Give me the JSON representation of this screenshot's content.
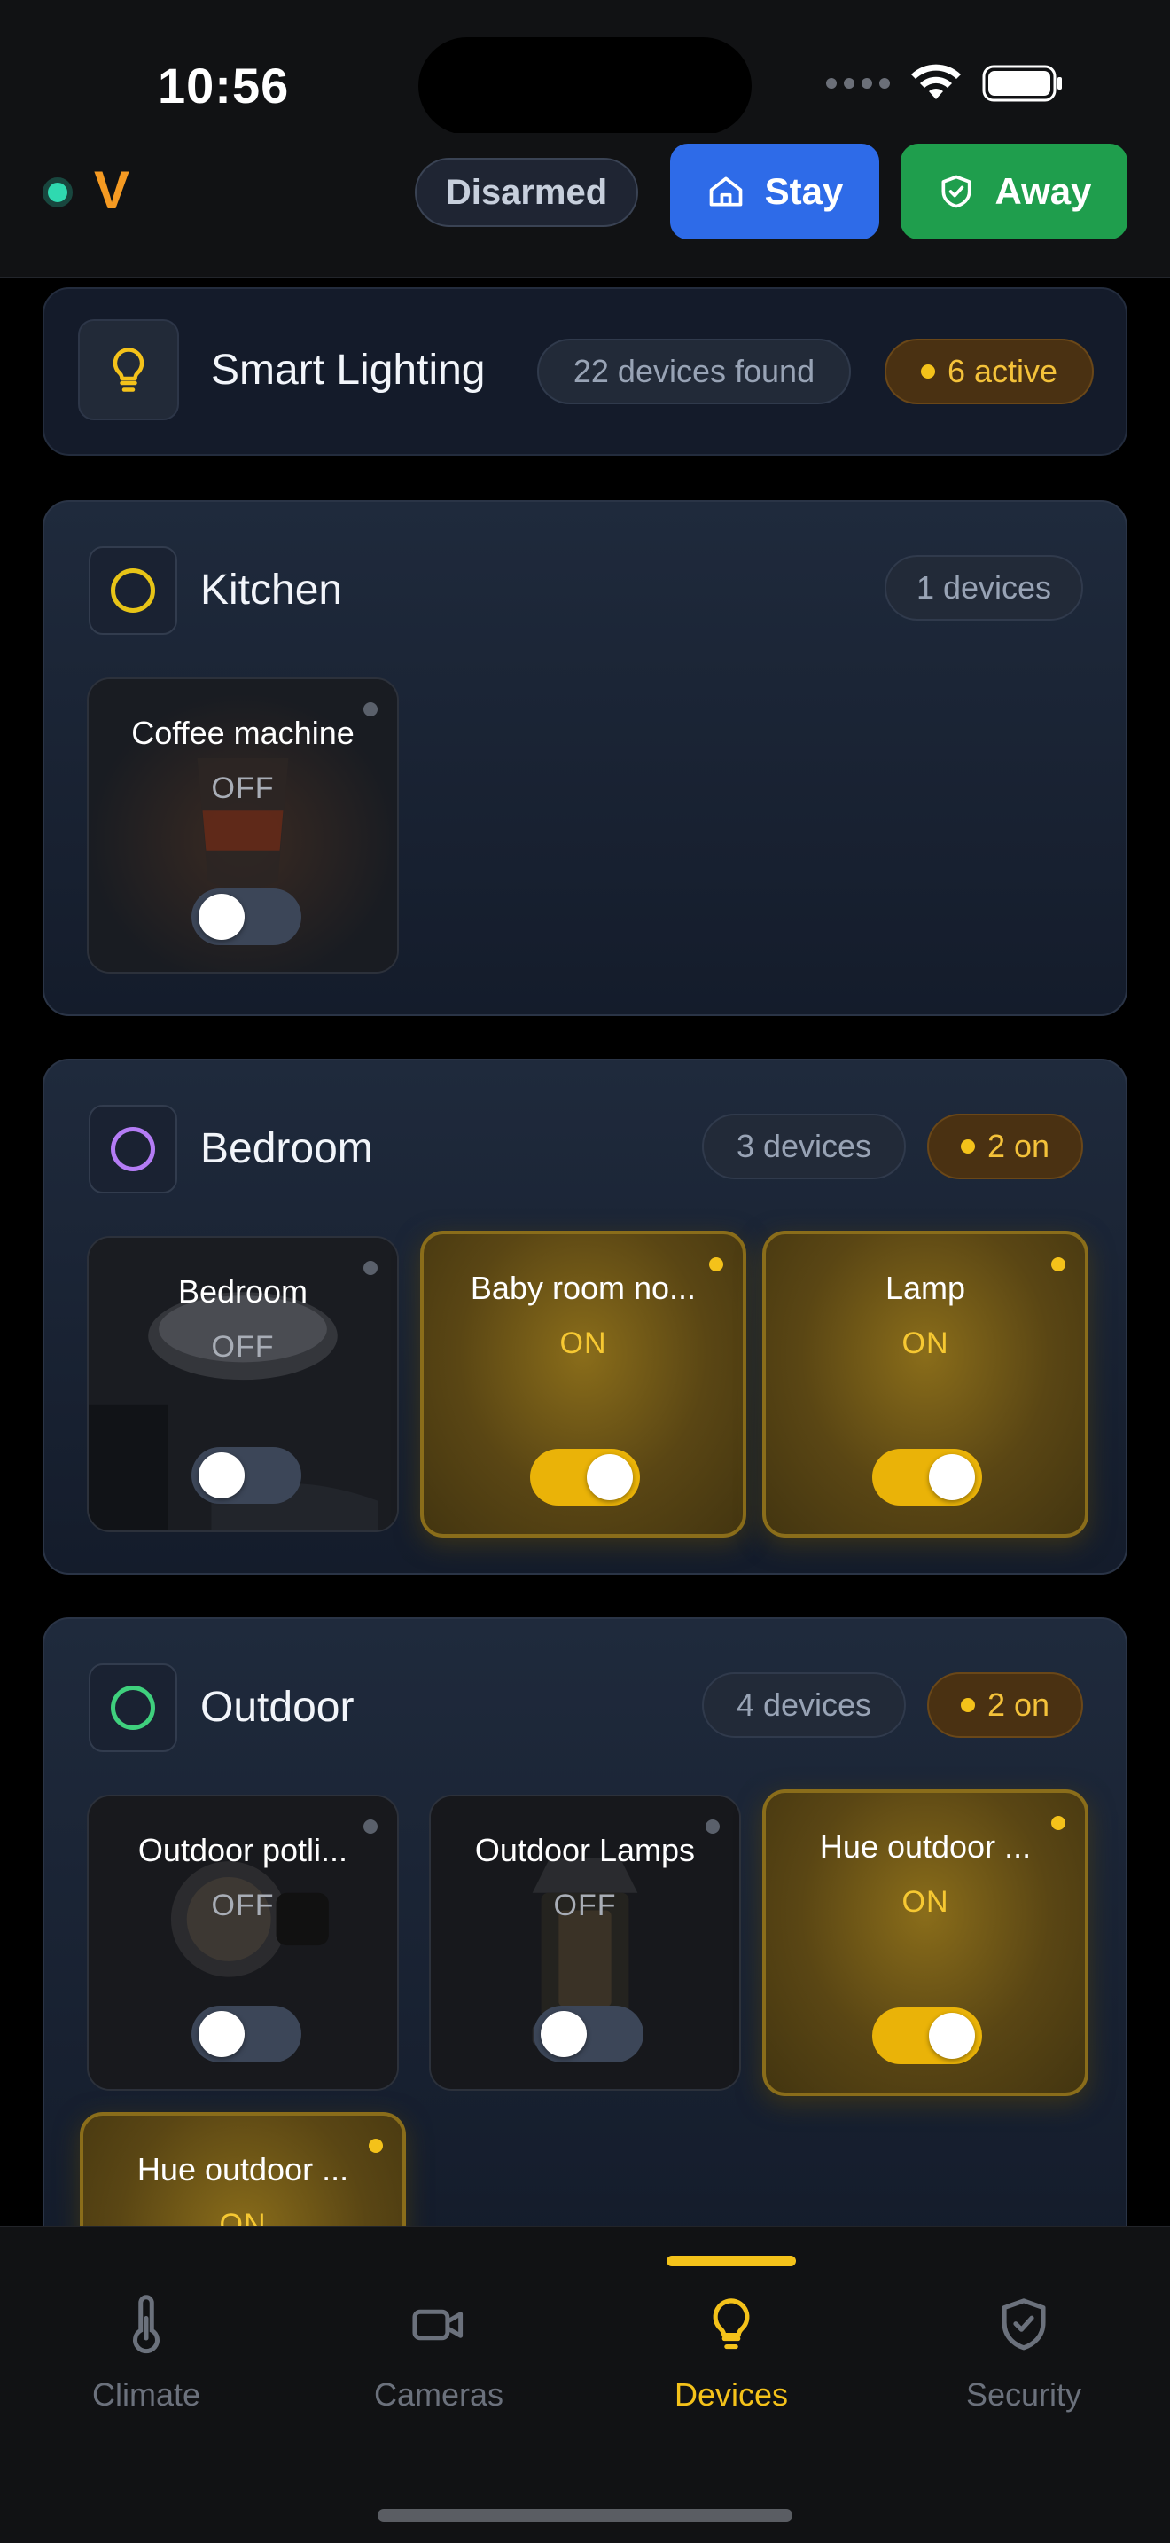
{
  "status_bar": {
    "time": "10:56"
  },
  "header": {
    "logo": "V",
    "alarm_state": "Disarmed",
    "stay_label": "Stay",
    "away_label": "Away"
  },
  "summary": {
    "title": "Smart Lighting",
    "devices_found": "22 devices found",
    "active": "6 active"
  },
  "rooms": [
    {
      "name": "Kitchen",
      "ring_color": "#e7c417",
      "device_count": "1 devices",
      "on_count": "",
      "devices": [
        {
          "name": "Coffee machine",
          "state": "OFF",
          "on": false
        }
      ]
    },
    {
      "name": "Bedroom",
      "ring_color": "#b47cf5",
      "device_count": "3 devices",
      "on_count": "2 on",
      "devices": [
        {
          "name": "Bedroom",
          "state": "OFF",
          "on": false
        },
        {
          "name": "Baby room no...",
          "state": "ON",
          "on": true
        },
        {
          "name": "Lamp",
          "state": "ON",
          "on": true
        }
      ]
    },
    {
      "name": "Outdoor",
      "ring_color": "#3fd07d",
      "device_count": "4 devices",
      "on_count": "2 on",
      "devices": [
        {
          "name": "Outdoor potli...",
          "state": "OFF",
          "on": false
        },
        {
          "name": "Outdoor Lamps",
          "state": "OFF",
          "on": false
        },
        {
          "name": "Hue outdoor ...",
          "state": "ON",
          "on": true
        },
        {
          "name": "Hue outdoor ...",
          "state": "ON",
          "on": true
        }
      ]
    }
  ],
  "nav": {
    "items": [
      {
        "label": "Climate",
        "icon": "thermometer-icon"
      },
      {
        "label": "Cameras",
        "icon": "camera-icon"
      },
      {
        "label": "Devices",
        "icon": "lightbulb-icon"
      },
      {
        "label": "Security",
        "icon": "shield-check-icon"
      }
    ],
    "active": "Devices"
  },
  "colors": {
    "accent": "#f4c21a",
    "stay_blue": "#2e6be8",
    "away_green": "#1f9e4d",
    "live_dot": "#2fd9b0",
    "logo_orange": "#f59a22"
  }
}
